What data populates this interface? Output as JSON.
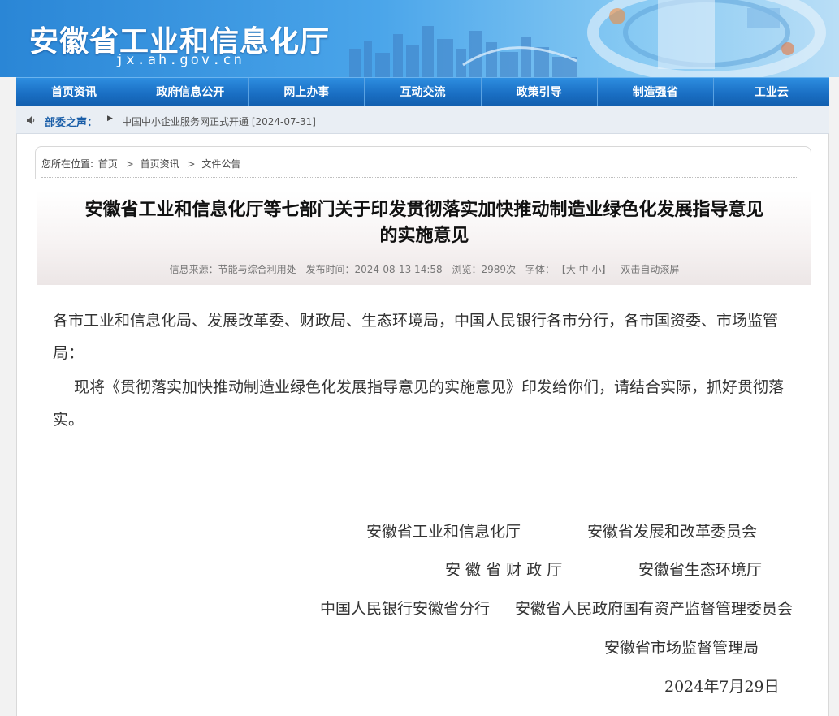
{
  "header": {
    "site_title": "安徽省工业和信息化厅",
    "domain": "jx.ah.gov.cn"
  },
  "nav": {
    "items": [
      "首页资讯",
      "政府信息公开",
      "网上办事",
      "互动交流",
      "政策引导",
      "制造强省",
      "工业云"
    ]
  },
  "notice": {
    "label": "部委之声：",
    "text": "中国中小企业服务网正式开通 [2024-07-31]"
  },
  "breadcrumb": {
    "prefix": "您所在位置:",
    "items": [
      "首页",
      "首页资讯",
      "文件公告"
    ],
    "separator": ">"
  },
  "article": {
    "title_line1": "安徽省工业和信息化厅等七部门关于印发贯彻落实加快推动制造业绿色化发展指导意见",
    "title_line2": "的实施意见",
    "meta": {
      "source": "信息来源：节能与综合利用处",
      "date": "发布时间：2024-08-13 14:58",
      "views": "浏览：2989次",
      "font_label": "字体：",
      "font_sizes": "【大 中 小】",
      "autoscroll": "双击自动滚屏"
    },
    "para1": "各市工业和信息化局、发展改革委、财政局、生态环境局，中国人民银行各市分行，各市国资委、市场监管局：",
    "para2": "现将《贯彻落实加快推动制造业绿色化发展指导意见的实施意见》印发给你们，请结合实际，抓好贯彻落实。",
    "signatures": {
      "s1": "安徽省工业和信息化厅",
      "s2": "安徽省发展和改革委员会",
      "s3": "安 徽 省 财 政 厅",
      "s4": "安徽省生态环境厅",
      "s5": "中国人民银行安徽省分行",
      "s6": "安徽省人民政府国有资产监督管理委员会",
      "s7": "安徽省市场监督管理局",
      "date": "2024年7月29日"
    }
  }
}
